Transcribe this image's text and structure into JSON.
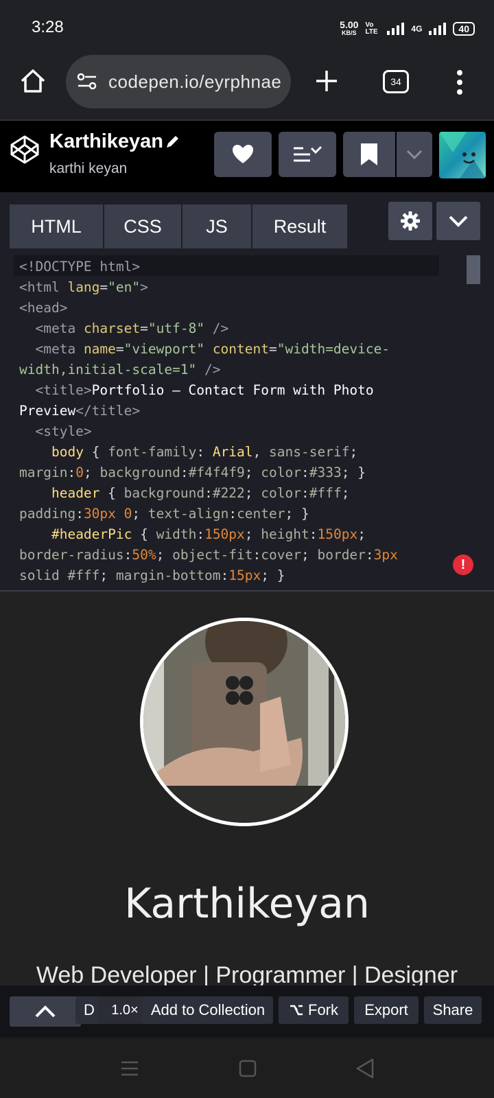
{
  "status_bar": {
    "time": "3:28",
    "speed_value": "5.00",
    "speed_unit": "KB/S",
    "volte_label": "Vo LTE",
    "network": "4G",
    "battery": "40"
  },
  "browser": {
    "url": "codepen.io/eyrphnae",
    "tab_count": "34",
    "home_icon": "home-icon",
    "site_settings_icon": "tune-icon",
    "new_tab_icon": "plus-icon",
    "menu_icon": "more-vertical-icon"
  },
  "pen_header": {
    "title": "Karthikeyan",
    "author": "karthi keyan",
    "edit_icon": "pencil-icon",
    "logo_icon": "codepen-logo-icon",
    "like_icon": "heart-icon",
    "layout_icon": "layout-menu-icon",
    "bookmark_icon": "bookmark-icon",
    "dropdown_icon": "chevron-down-icon"
  },
  "editor_tabs": [
    "HTML",
    "CSS",
    "JS",
    "Result"
  ],
  "code_lines": {
    "l1": "<!DOCTYPE html>",
    "t_html_open": "<html",
    "a_lang": "lang",
    "eq": "=",
    "v_en": "\"en\"",
    "gt": ">",
    "t_head": "<head>",
    "t_meta": "<meta",
    "a_charset": "charset",
    "v_utf8": "\"utf-8\"",
    "selfclose": " />",
    "a_name": "name",
    "v_viewport": "\"viewport\"",
    "a_content": "content",
    "v_content1": "\"width=device-",
    "v_content2": "width,initial-scale=1\"",
    "t_title_open": "<title>",
    "title_text1": "Portfolio — Contact Form with Photo",
    "title_text2": "Preview",
    "t_title_close": "</title>",
    "t_style": "<style>",
    "body_sel": "body",
    "font_family": "font-family",
    "arial": "Arial",
    "sans": "sans-serif",
    "margin": "margin",
    "zero": "0",
    "background": "background",
    "bg1": "#f4f4f9",
    "color": "color",
    "c333": "#333",
    "header_sel": "header",
    "bg222": "#222",
    "cfff": "#fff",
    "padding": "padding",
    "pad30": "30px",
    "text_align": "text-align",
    "center": "center",
    "headerpic_sel": "#headerPic",
    "width": "width",
    "px150": "150px",
    "height": "height",
    "border_radius": "border-radius",
    "pct50": "50%",
    "object_fit": "object-fit",
    "cover": "cover",
    "border": "border",
    "px3": "3px",
    "solid": "solid",
    "margin_bottom": "margin-bottom",
    "px15": "15px"
  },
  "result": {
    "name": "Karthikeyan",
    "role": "Web Developer | Programmer | Designer"
  },
  "bottom_bar": {
    "collapse_icon": "chevron-up-icon",
    "d_label": "D",
    "zoom": "1.0×",
    "add_to_collection": "Add to Collection",
    "fork": "Fork",
    "export": "Export",
    "share": "Share"
  },
  "nav": {
    "menu_icon": "recent-apps-icon",
    "home_icon": "home-square-icon",
    "back_icon": "back-triangle-icon"
  },
  "colors": {
    "codepen_header": "#000000",
    "tab_bg": "#3b3f4c",
    "editor_bg": "#1e1f26",
    "error": "#e52c3a"
  }
}
